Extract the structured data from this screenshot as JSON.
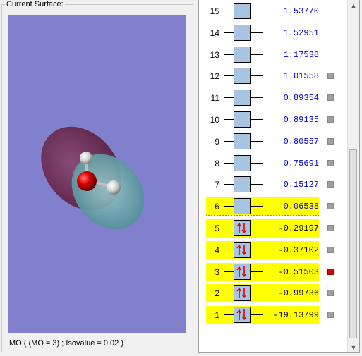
{
  "surface": {
    "group_title": "Current Surface:",
    "status": "MO ( (MO = 3) ; Isovalue = 0.02 )"
  },
  "orbitals": [
    {
      "num": "15",
      "energy": "1.53770",
      "occupancy": 0,
      "highlighted": false,
      "checkbox": false,
      "selected": false
    },
    {
      "num": "14",
      "energy": "1.52951",
      "occupancy": 0,
      "highlighted": false,
      "checkbox": false,
      "selected": false
    },
    {
      "num": "13",
      "energy": "1.17538",
      "occupancy": 0,
      "highlighted": false,
      "checkbox": false,
      "selected": false
    },
    {
      "num": "12",
      "energy": "1.01558",
      "occupancy": 0,
      "highlighted": false,
      "checkbox": true,
      "selected": false
    },
    {
      "num": "11",
      "energy": "0.89354",
      "occupancy": 0,
      "highlighted": false,
      "checkbox": true,
      "selected": false
    },
    {
      "num": "10",
      "energy": "0.89135",
      "occupancy": 0,
      "highlighted": false,
      "checkbox": true,
      "selected": false
    },
    {
      "num": "9",
      "energy": "0.80557",
      "occupancy": 0,
      "highlighted": false,
      "checkbox": true,
      "selected": false
    },
    {
      "num": "8",
      "energy": "0.75691",
      "occupancy": 0,
      "highlighted": false,
      "checkbox": true,
      "selected": false
    },
    {
      "num": "7",
      "energy": "0.15127",
      "occupancy": 0,
      "highlighted": false,
      "checkbox": true,
      "selected": false
    },
    {
      "num": "6",
      "energy": "0.06538",
      "occupancy": 0,
      "highlighted": true,
      "checkbox": true,
      "selected": false
    },
    {
      "num": "5",
      "energy": "-0.29197",
      "occupancy": 2,
      "highlighted": true,
      "checkbox": true,
      "selected": false
    },
    {
      "num": "4",
      "energy": "-0.37102",
      "occupancy": 2,
      "highlighted": true,
      "checkbox": true,
      "selected": false
    },
    {
      "num": "3",
      "energy": "-0.51503",
      "occupancy": 2,
      "highlighted": true,
      "checkbox": true,
      "selected": true
    },
    {
      "num": "2",
      "energy": "-0.99736",
      "occupancy": 2,
      "highlighted": true,
      "checkbox": true,
      "selected": false
    },
    {
      "num": "1",
      "energy": "-19.13799",
      "occupancy": 2,
      "highlighted": true,
      "checkbox": true,
      "selected": false
    }
  ],
  "scroll": {
    "up_icon": "arrow-up-icon",
    "down_icon": "arrow-down-icon"
  },
  "colors": {
    "viewer_background": "#8080cc",
    "highlight": "#ffff00",
    "virtual_energy": "#0000cc",
    "occupied_energy": "#000000",
    "selected_checkbox": "#e00000",
    "electron_arrow": "#e00000"
  }
}
